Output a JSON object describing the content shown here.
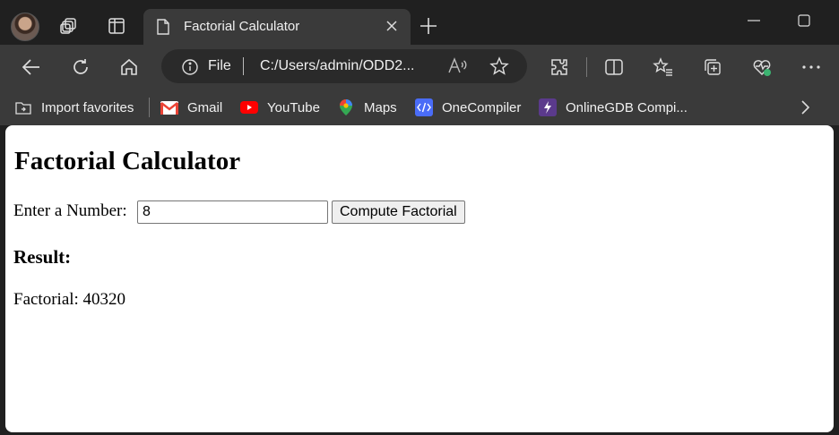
{
  "browser": {
    "tab": {
      "title": "Factorial Calculator"
    },
    "address": {
      "scheme_label": "File",
      "url": "C:/Users/admin/ODD2..."
    },
    "favorites": [
      {
        "label": "Import favorites",
        "icon": "import-favorites-icon"
      },
      {
        "label": "Gmail",
        "icon": "gmail-icon"
      },
      {
        "label": "YouTube",
        "icon": "youtube-icon"
      },
      {
        "label": "Maps",
        "icon": "maps-icon"
      },
      {
        "label": "OneCompiler",
        "icon": "onecompiler-icon"
      },
      {
        "label": "OnlineGDB Compi...",
        "icon": "onlinegdb-icon"
      }
    ],
    "colors": {
      "frame": "#202020",
      "toolbar": "#3a3a3a",
      "youtube": "#ff0000",
      "onecompiler": "#4a6cf7",
      "onlinegdb": "#5b3a8c"
    }
  },
  "page": {
    "heading": "Factorial Calculator",
    "input_label": "Enter a Number:",
    "input_value": "8",
    "button_label": "Compute Factorial",
    "result_heading": "Result:",
    "result_text": "Factorial: 40320"
  }
}
